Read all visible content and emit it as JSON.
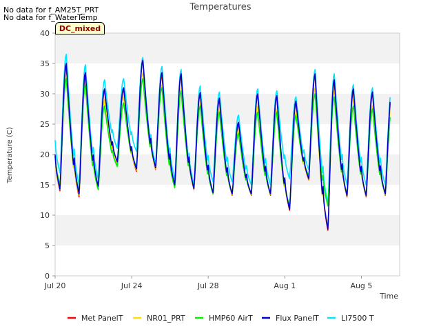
{
  "notes": [
    "No data for f_AM25T_PRT",
    "No data for f_WaterTemp"
  ],
  "badge": "DC_mixed",
  "chart_data": {
    "type": "line",
    "title": "Temperatures",
    "xlabel": "Time",
    "ylabel": "Temperature (C)",
    "xlim": [
      "2024-07-20",
      "2024-08-07"
    ],
    "ylim": [
      0,
      40
    ],
    "x_ticks": [
      "Jul 20",
      "Jul 24",
      "Jul 28",
      "Aug 1",
      "Aug 5"
    ],
    "x_tick_dates": [
      "2024-07-20",
      "2024-07-24",
      "2024-07-28",
      "2024-08-01",
      "2024-08-05"
    ],
    "y_ticks": [
      0,
      5,
      10,
      15,
      20,
      25,
      30,
      35,
      40
    ],
    "grid": "horizontal bands",
    "legend_position": "bottom",
    "dates": [
      "2024-07-20",
      "2024-07-21",
      "2024-07-22",
      "2024-07-23",
      "2024-07-24",
      "2024-07-25",
      "2024-07-26",
      "2024-07-27",
      "2024-07-28",
      "2024-07-29",
      "2024-07-30",
      "2024-07-31",
      "2024-08-01",
      "2024-08-02",
      "2024-08-03",
      "2024-08-04",
      "2024-08-05",
      "2024-08-06"
    ],
    "series": [
      {
        "name": "Met PanelT",
        "color": "#ff0000",
        "daily_min": [
          14.0,
          13.0,
          14.5,
          18.5,
          17.2,
          17.5,
          14.8,
          14.2,
          13.5,
          13.3,
          13.3,
          13.3,
          10.8,
          15.8,
          7.5,
          13.0,
          13.0,
          13.3
        ],
        "daily_max": [
          34.5,
          33.0,
          30.5,
          30.8,
          35.5,
          33.0,
          33.0,
          30.0,
          29.0,
          25.0,
          29.8,
          29.5,
          28.5,
          33.0,
          32.0,
          30.5,
          30.0,
          30.0
        ]
      },
      {
        "name": "NR01_PRT",
        "color": "#ffdd00",
        "daily_min": [
          14.2,
          13.3,
          14.6,
          18.6,
          17.4,
          17.6,
          15.0,
          14.3,
          13.6,
          13.4,
          13.4,
          13.4,
          11.0,
          15.9,
          8.0,
          13.1,
          13.1,
          13.4
        ],
        "daily_max": [
          33.0,
          31.5,
          29.0,
          29.5,
          33.5,
          31.5,
          31.0,
          28.5,
          27.5,
          24.0,
          28.0,
          27.5,
          27.0,
          31.0,
          30.5,
          29.0,
          28.0,
          28.5
        ]
      },
      {
        "name": "HMP60 AirT",
        "color": "#00ee00",
        "daily_min": [
          15.0,
          14.0,
          14.2,
          18.0,
          18.0,
          18.0,
          14.5,
          14.5,
          13.5,
          13.5,
          13.5,
          13.5,
          11.5,
          16.5,
          11.5,
          13.5,
          13.5,
          13.5
        ],
        "daily_max": [
          32.5,
          31.5,
          28.0,
          28.5,
          32.5,
          31.0,
          30.5,
          28.0,
          27.0,
          23.5,
          27.0,
          27.0,
          26.5,
          30.0,
          29.5,
          28.0,
          27.5,
          27.5
        ]
      },
      {
        "name": "Flux PanelT",
        "color": "#0000cc",
        "daily_min": [
          14.3,
          13.5,
          14.8,
          18.8,
          17.6,
          17.8,
          15.0,
          14.4,
          13.7,
          13.5,
          13.5,
          13.5,
          11.0,
          16.0,
          7.7,
          13.2,
          13.2,
          13.5
        ],
        "daily_max": [
          35.0,
          33.5,
          30.8,
          31.0,
          35.5,
          33.5,
          33.3,
          30.2,
          29.3,
          25.3,
          30.0,
          29.7,
          28.8,
          33.3,
          32.3,
          30.8,
          30.3,
          30.3
        ]
      },
      {
        "name": "LI7500 T",
        "color": "#00e5ff",
        "daily_min": [
          17.0,
          15.0,
          16.0,
          21.0,
          20.5,
          18.5,
          16.0,
          15.0,
          15.5,
          15.5,
          15.0,
          15.0,
          16.0,
          17.5,
          12.0,
          15.0,
          15.0,
          15.0
        ],
        "daily_max": [
          36.5,
          34.8,
          32.3,
          32.5,
          36.0,
          34.5,
          34.0,
          31.3,
          30.3,
          26.5,
          30.8,
          30.5,
          29.5,
          34.0,
          33.3,
          31.5,
          31.0,
          31.0
        ]
      }
    ]
  }
}
